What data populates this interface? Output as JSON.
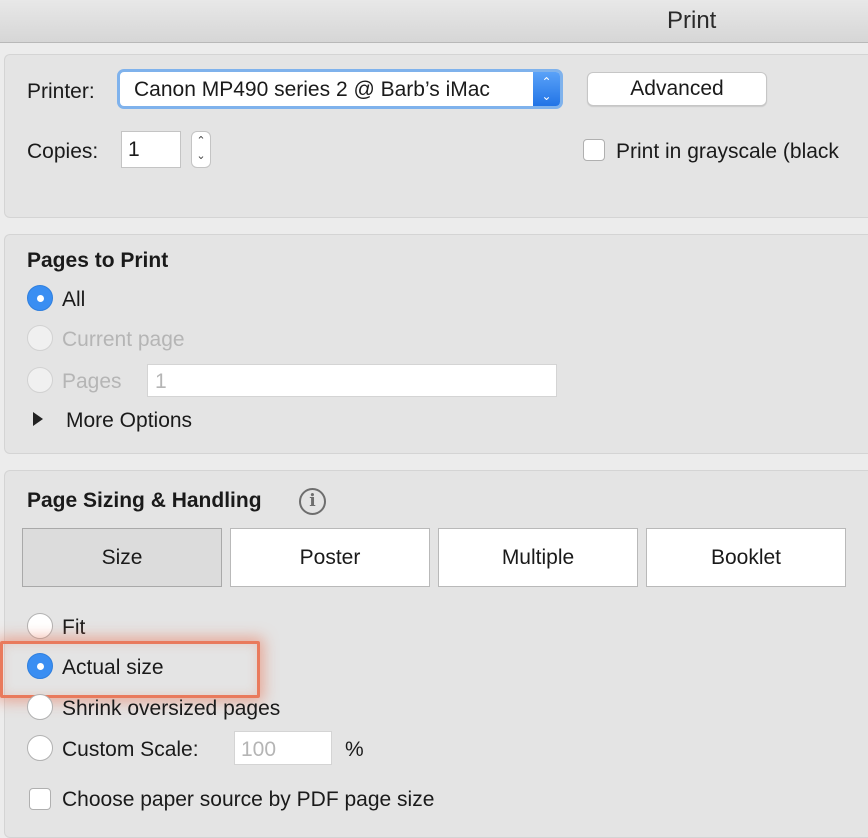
{
  "window": {
    "title": "Print"
  },
  "printer": {
    "label": "Printer:",
    "selected": "Canon MP490 series 2 @ Barb’s iMac",
    "advanced_label": "Advanced",
    "copies_label": "Copies:",
    "copies_value": "1",
    "grayscale_label": "Print in grayscale (black",
    "grayscale_checked": false
  },
  "pages_to_print": {
    "heading": "Pages to Print",
    "options": [
      {
        "label": "All",
        "selected": true,
        "enabled": true
      },
      {
        "label": "Current page",
        "selected": false,
        "enabled": false
      },
      {
        "label": "Pages",
        "selected": false,
        "enabled": false
      }
    ],
    "pages_range_value": "1",
    "more_options_label": "More Options"
  },
  "page_sizing": {
    "heading": "Page Sizing & Handling",
    "tabs": [
      {
        "label": "Size",
        "selected": true
      },
      {
        "label": "Poster",
        "selected": false
      },
      {
        "label": "Multiple",
        "selected": false
      },
      {
        "label": "Booklet",
        "selected": false
      }
    ],
    "options": [
      {
        "label": "Fit",
        "selected": false
      },
      {
        "label": "Actual size",
        "selected": true
      },
      {
        "label": "Shrink oversized pages",
        "selected": false
      },
      {
        "label": "Custom Scale:",
        "selected": false
      }
    ],
    "custom_scale_value": "100",
    "custom_scale_unit": "%",
    "paper_source_label": "Choose paper source by PDF page size",
    "paper_source_checked": false
  },
  "colors": {
    "accent": "#3a8ef2",
    "highlight": "#e97a5c"
  }
}
